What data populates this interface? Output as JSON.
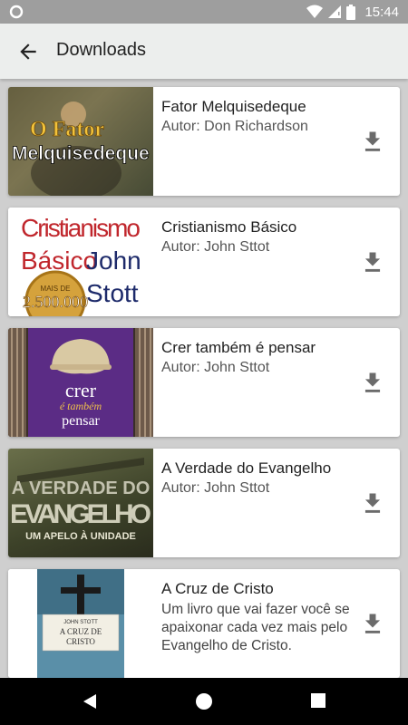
{
  "status_bar": {
    "time": "15:44"
  },
  "app_bar": {
    "title": "Downloads"
  },
  "books": [
    {
      "title": "Fator Melquisedeque",
      "author": "Autor: Don Richardson",
      "cover": {
        "line1": "O Fator",
        "line2": "Melquisedeque"
      }
    },
    {
      "title": "Cristianismo Básico",
      "author": "Autor: John Sttot",
      "cover": {
        "line1": "Cristianismo",
        "line2": "Básico",
        "line3": "John",
        "line4": "Stott",
        "seal_line1": "MAIS DE",
        "seal_line2": "2.500.000"
      }
    },
    {
      "title": "Crer também é pensar",
      "author": "Autor: John Sttot",
      "cover": {
        "line1": "crer",
        "line2": "é também",
        "line3": "pensar"
      }
    },
    {
      "title": "A Verdade do Evangelho",
      "author": "Autor: John Sttot",
      "cover": {
        "line1": "A VERDADE DO",
        "line2": "EVANGELHO",
        "line3": "UM APELO À UNIDADE"
      }
    },
    {
      "title": "A Cruz de Cristo",
      "description": "Um livro que vai fazer você se apaixonar cada vez mais pelo Evangelho de Cristo.",
      "cover": {
        "author": "JOHN STOTT",
        "line1": "A CRUZ DE",
        "line2": "CRISTO"
      }
    }
  ],
  "colors": {
    "status_bar": "#9e9e9e",
    "app_bar": "#eceeed",
    "background": "#cfcfcf",
    "download_icon": "#6b6b6b",
    "nav_bar": "#000000"
  },
  "icons": [
    "back-arrow-icon",
    "download-icon",
    "wifi-icon",
    "signal-icon",
    "battery-icon",
    "nav-back-icon",
    "nav-home-icon",
    "nav-recents-icon"
  ]
}
